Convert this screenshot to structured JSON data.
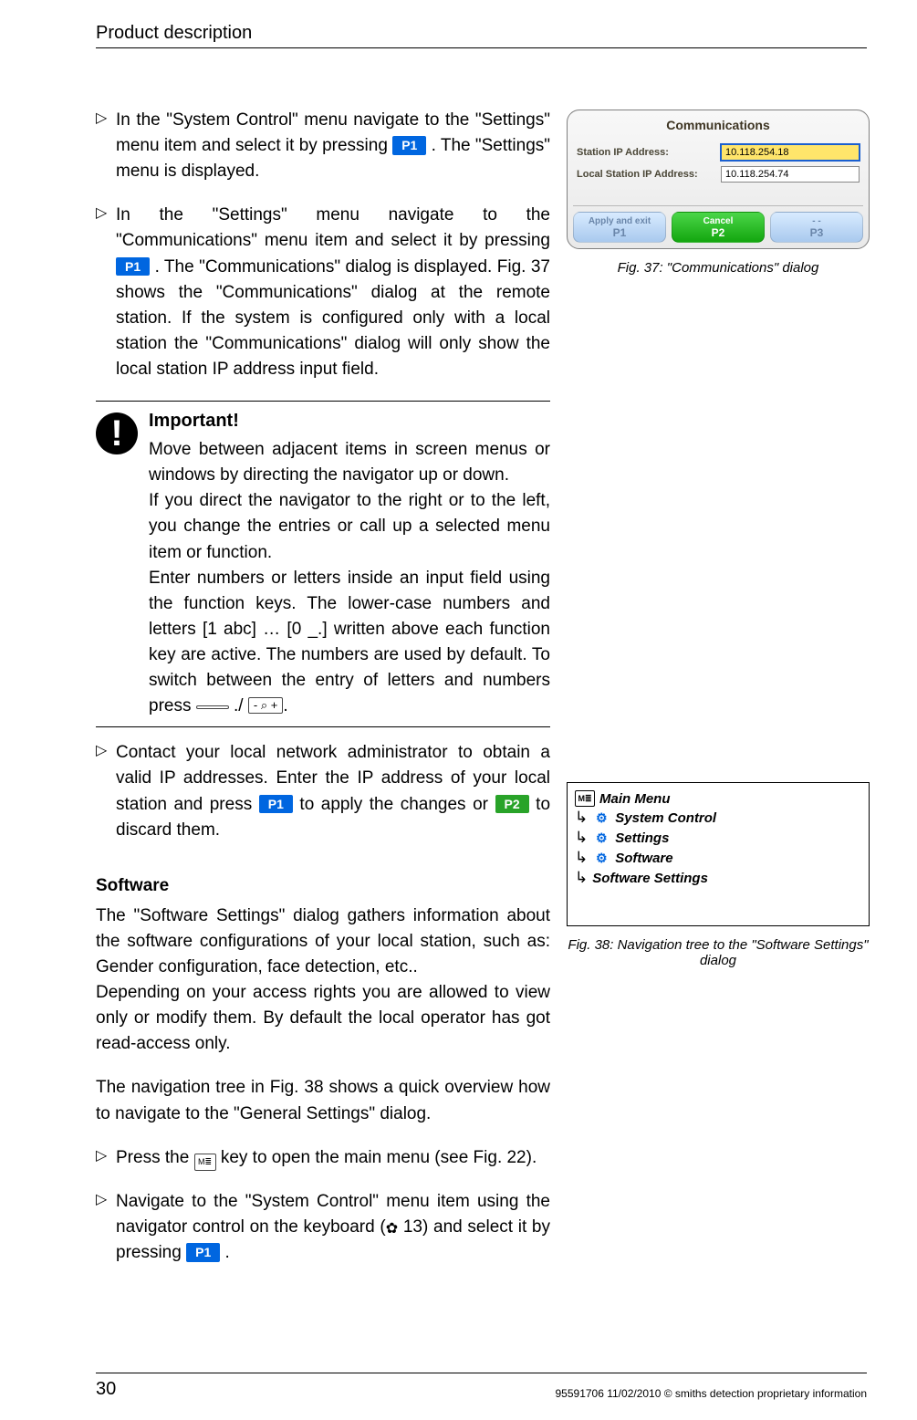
{
  "header": {
    "title": "Product description"
  },
  "steps": {
    "s1a": "In the \"System Control\" menu navigate to the \"Settings\" menu item and select it by pressing ",
    "s1b": ". The \"Settings\" menu is displayed.",
    "s2a": "In the \"Settings\" menu navigate to the \"Communications\" menu item and select it by pressing ",
    "s2b": ". The \"Communications\" dialog is displayed. Fig. 37 shows the \"Communications\" dialog at the remote station. If the system is configured only with a local station the \"Communications\" dialog will only show the local station IP address input field.",
    "s3a": "Contact your local network administrator to obtain a valid IP addresses. Enter the IP address of your local station and press ",
    "s3b": " to apply the changes or ",
    "s3c": " to discard them.",
    "s4": "Press the ",
    "s4b": " key to open the main menu (see Fig. 22).",
    "s5a": "Navigate to the \"System Control\" menu item using the navigator control on the keyboard (",
    "s5b": " 13) and select it by pressing ",
    "s5c": "."
  },
  "keys": {
    "p1": "P1",
    "p2": "P2",
    "p3": "P3",
    "blank": " ",
    "zoom": "- ⌕ +"
  },
  "note": {
    "title": "Important!",
    "p1": "Move between adjacent items in screen menus or windows by directing the navigator up or down.",
    "p2": "If you direct the navigator to the right or to the left, you change the entries or call up a selected menu item or function.",
    "p3": "Enter numbers or letters inside an input field using the function keys. The lower-case numbers and letters [1 abc] … [0 _.] written above each function key are active. The numbers are used by default. To switch between the entry of letters and numbers press ",
    "p3b": "./ ",
    "p3c": "."
  },
  "software": {
    "heading": "Software",
    "p1": "The \"Software Settings\" dialog gathers information about the software configurations of your local station, such as: Gender configuration, face detection, etc..",
    "p2": "Depending on your access rights you are allowed to view only or modify them. By default the local operator has got read-access only.",
    "p3": "The navigation tree in Fig. 38 shows a quick overview how to navigate to the \"General Settings\" dialog."
  },
  "comm": {
    "title": "Communications",
    "label1": "Station IP Address:",
    "value1": "10.118.254.18",
    "label2": "Local Station IP Address:",
    "value2": "10.118.254.74",
    "btn_apply": "Apply and exit",
    "btn_cancel": "Cancel",
    "btn_dash": "- -"
  },
  "fig37": "Fig. 37: \"Communications\" dialog",
  "navtree": {
    "l0": "Main Menu",
    "l1": "System Control",
    "l2": "Settings",
    "l3": "Software",
    "l4": "Software Settings"
  },
  "fig38": "Fig. 38: Navigation tree to the \"Software Settings\" dialog",
  "footer": {
    "page": "30",
    "copy": "95591706 11/02/2010 © smiths detection proprietary information"
  },
  "glyph": {
    "tri": "▷",
    "m_icon": "M≣",
    "gear": "⚙",
    "subarrow": "↳",
    "pointer": "✿"
  }
}
